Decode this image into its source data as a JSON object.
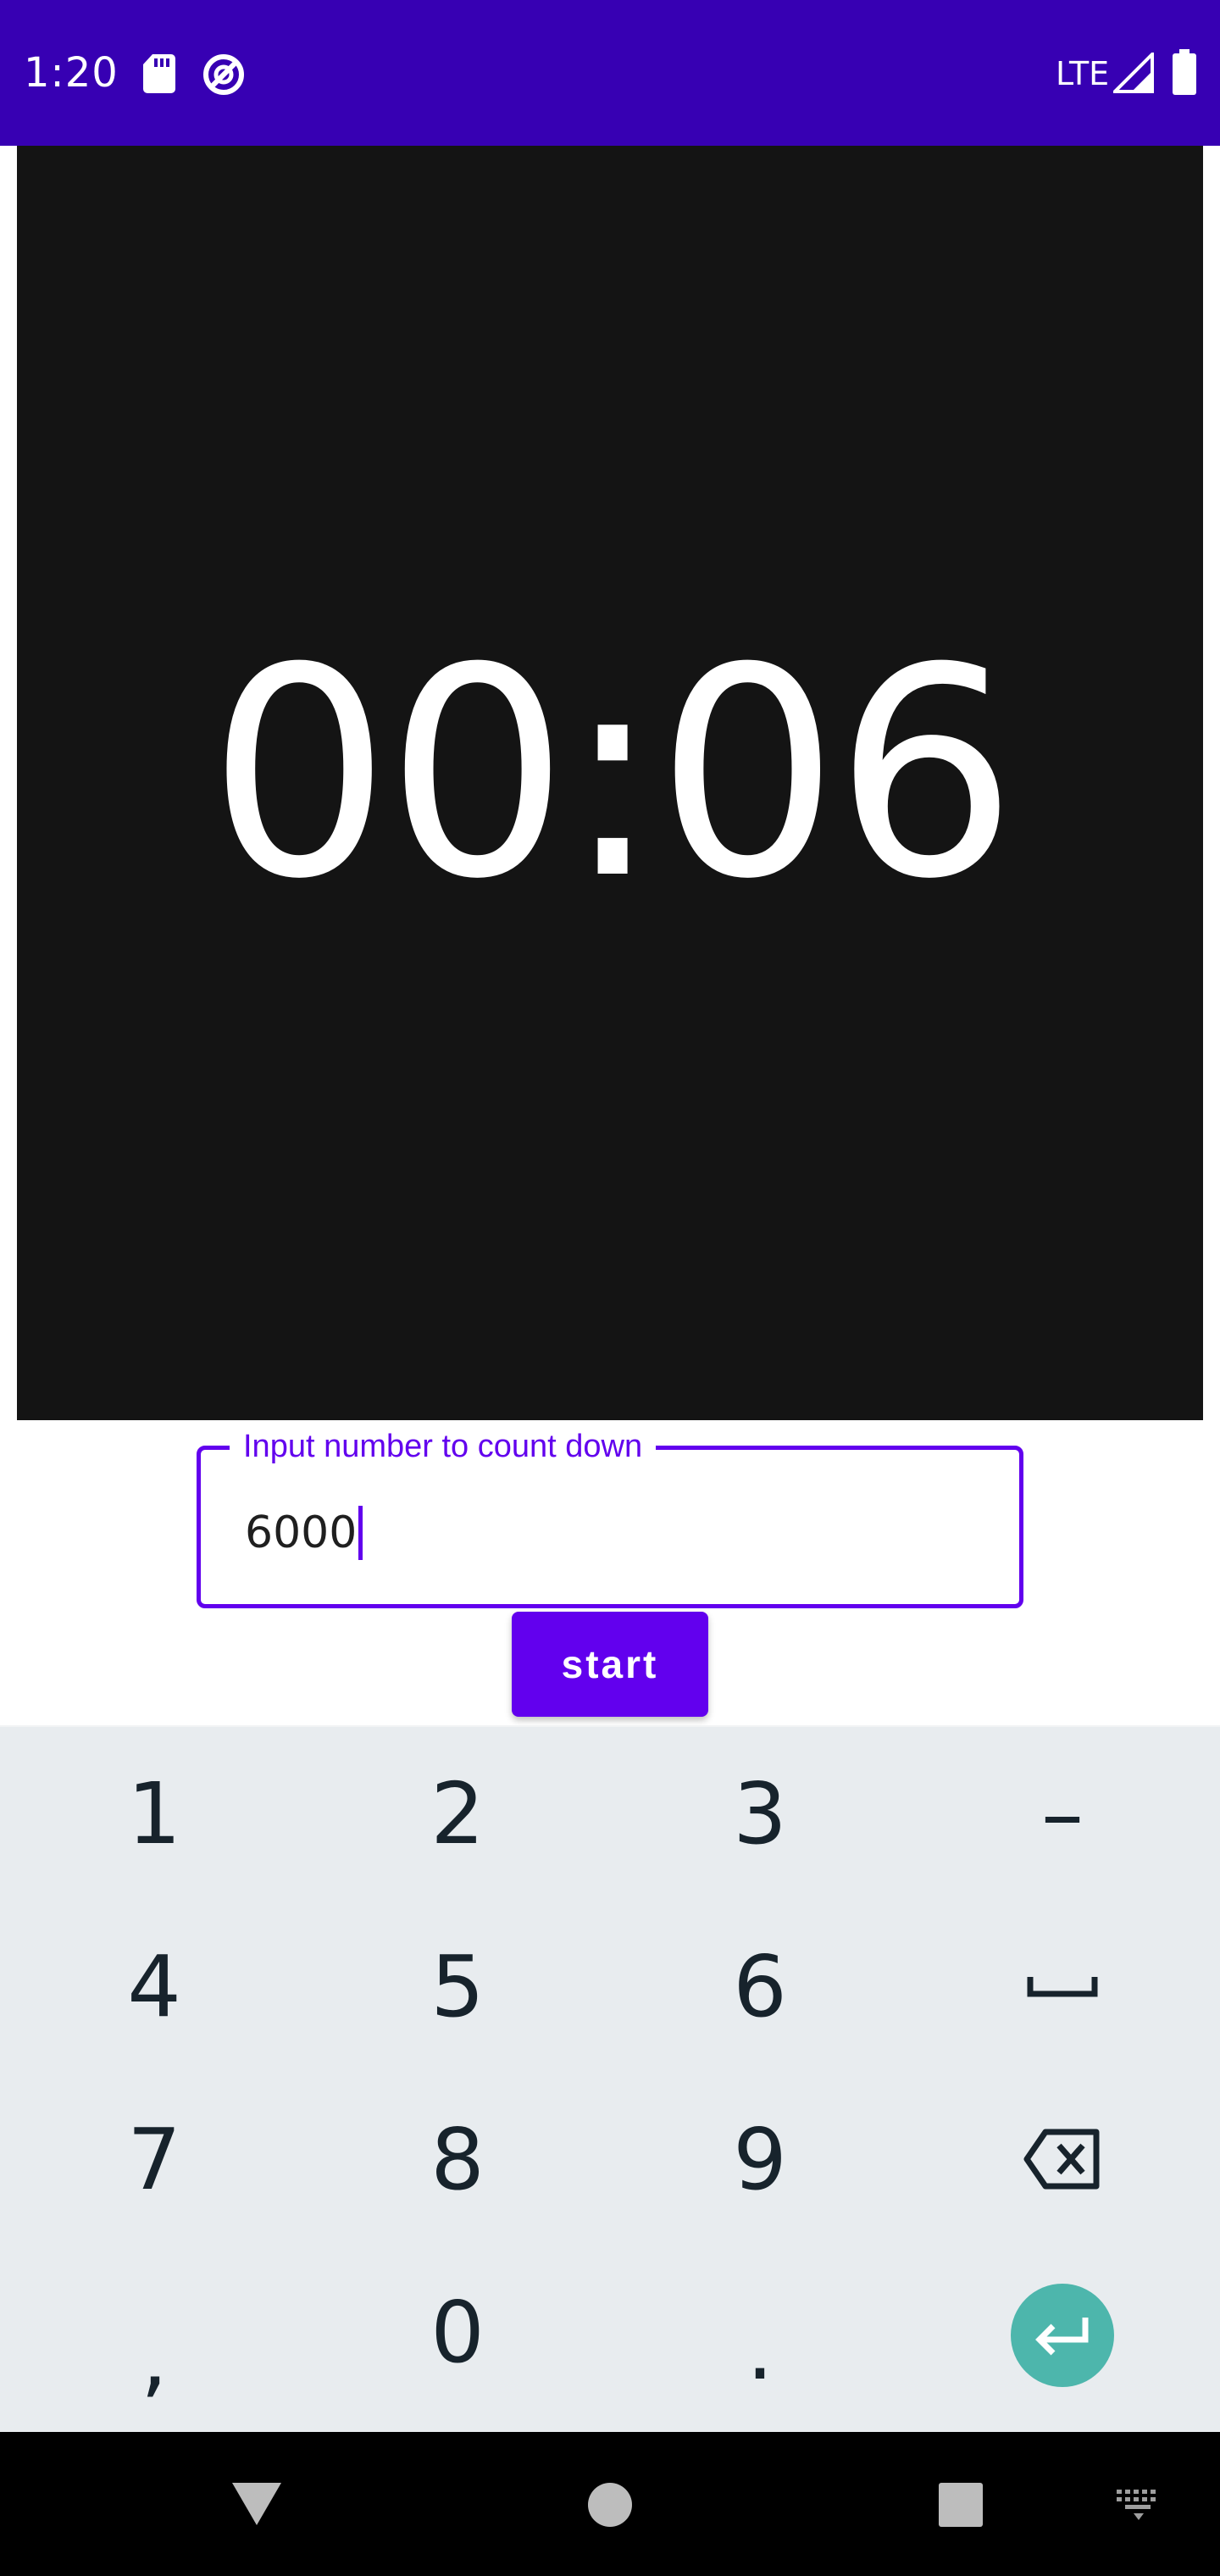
{
  "status_bar": {
    "time": "1:20",
    "network": "LTE",
    "icons": [
      "sd-card-icon",
      "do-not-disturb-icon",
      "signal-icon",
      "battery-icon"
    ],
    "background": "#3700b3"
  },
  "timer": {
    "display": "00:06",
    "background": "#141414"
  },
  "count_input": {
    "label": "Input number to count down",
    "value": "6000",
    "accent": "#6200ee"
  },
  "start_button": {
    "label": "start",
    "color": "#6200ee"
  },
  "keyboard": {
    "rows": [
      [
        {
          "label": "1"
        },
        {
          "label": "2"
        },
        {
          "label": "3"
        },
        {
          "label": "–"
        }
      ],
      [
        {
          "label": "4"
        },
        {
          "label": "5"
        },
        {
          "label": "6"
        },
        {
          "icon": "space-icon"
        }
      ],
      [
        {
          "label": "7"
        },
        {
          "label": "8"
        },
        {
          "label": "9"
        },
        {
          "icon": "backspace-icon"
        }
      ],
      [
        {
          "label": ","
        },
        {
          "label": "0"
        },
        {
          "label": "."
        },
        {
          "icon": "enter-icon"
        }
      ]
    ],
    "enter_color": "#4db6ac",
    "background": "#e8ecef"
  },
  "nav_bar": {
    "buttons": [
      "back-icon",
      "home-icon",
      "recents-icon",
      "keyboard-switch-icon"
    ]
  }
}
